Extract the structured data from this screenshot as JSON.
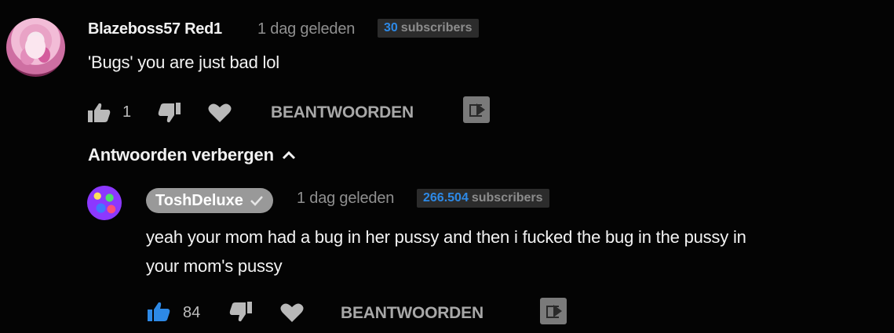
{
  "comment": {
    "author": "Blazeboss57 Red1",
    "time": "1 dag geleden",
    "subscribers": {
      "count": "30",
      "label": "subscribers"
    },
    "text": "'Bugs' you are just bad lol",
    "likes": "1",
    "reply_label": "BEANTWOORDEN",
    "toggle_label": "Antwoorden verbergen"
  },
  "reply": {
    "author": "ToshDeluxe",
    "verified": true,
    "time": "1 dag geleden",
    "subscribers": {
      "count": "266.504",
      "label": "subscribers"
    },
    "text_lines": [
      "yeah your mom had a bug in her pussy and then i fucked the bug in the pussy in",
      "your mom's pussy"
    ],
    "likes": "84",
    "liked": true,
    "reply_label": "BEANTWOORDEN"
  },
  "colors": {
    "background": "#040404",
    "accent": "#2d89e6",
    "muted": "#8f8f8f",
    "icon": "#b9b9b9",
    "chip": "#999999"
  },
  "icons": {
    "like": "thumbs-up-icon",
    "dislike": "thumbs-down-icon",
    "heart": "heart-icon",
    "share": "share-icon",
    "chevron": "chevron-up-icon",
    "verified": "check-icon"
  }
}
